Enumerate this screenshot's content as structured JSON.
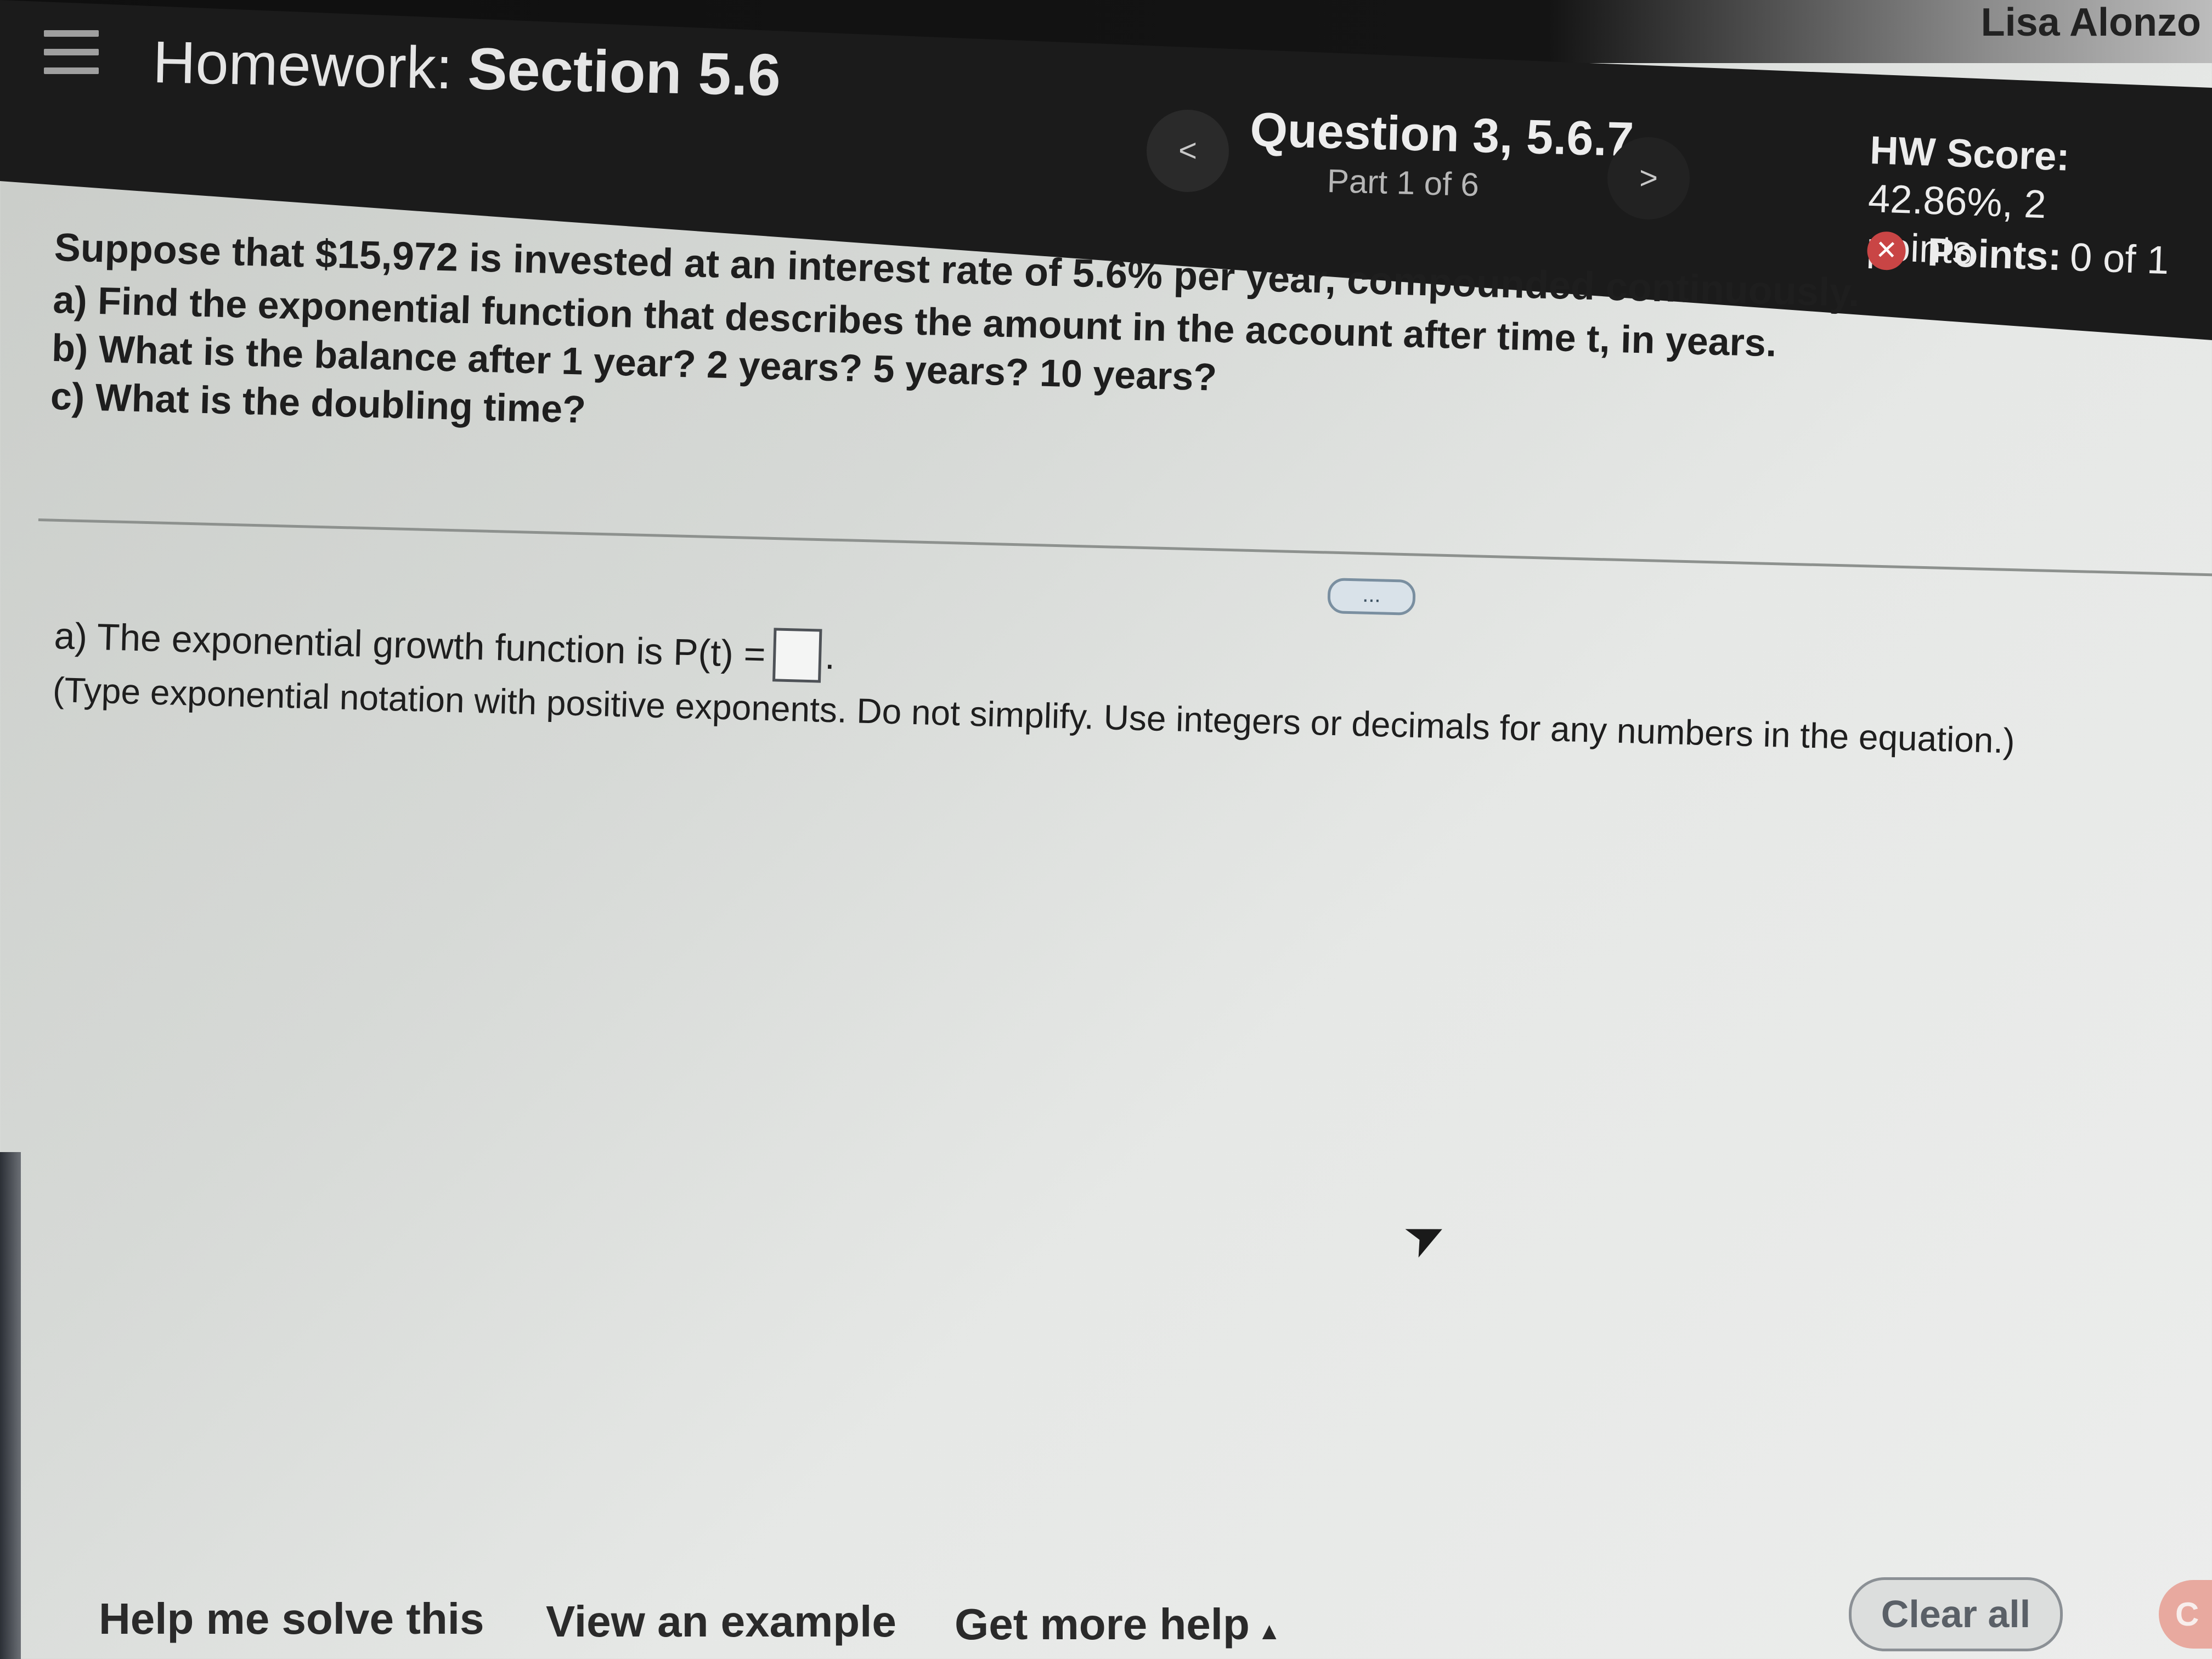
{
  "user": {
    "name": "Lisa Alonzo"
  },
  "header": {
    "title_prefix": "Homework:",
    "title_section": "Section 5.6",
    "question_title": "Question 3, 5.6.7",
    "question_part": "Part 1 of 6",
    "prev_icon": "<",
    "next_icon": ">",
    "hw_score_label": "HW Score:",
    "hw_score_value": "42.86%, 2",
    "hw_score_unit": "points",
    "points_label": "Points:",
    "points_value": "0 of 1",
    "incorrect_icon": "✕"
  },
  "problem": {
    "intro": "Suppose that $15,972 is invested at an interest rate of 5.6% per year, compounded continuously.",
    "part_a": "a) Find the exponential function that describes the amount in the account after time t, in years.",
    "part_b": "b) What is the balance after 1 year? 2 years? 5 years? 10 years?",
    "part_c": "c) What is the doubling time?"
  },
  "more_button": "...",
  "answer": {
    "prompt": "a) The exponential growth function is P(t) =",
    "period": ".",
    "instructions": "(Type exponential notation with positive exponents. Do not simplify. Use integers or decimals for any numbers in the equation.)"
  },
  "footer": {
    "help_me_solve": "Help me solve this",
    "view_example": "View an example",
    "get_more_help": "Get more help",
    "get_more_help_caret": "▲",
    "clear_all": "Clear all",
    "check_answer": "C"
  },
  "colors": {
    "header_bg": "#1b1b1b",
    "incorrect_badge": "#c94545",
    "check_button": "#e8a99f"
  }
}
